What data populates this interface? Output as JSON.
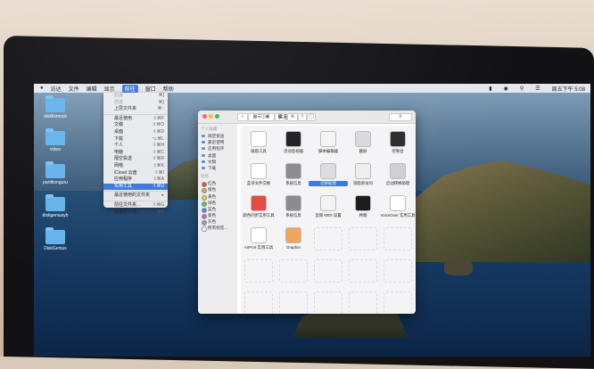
{
  "menubar": {
    "apple_icon": "apple-logo-icon",
    "items": [
      "访达",
      "文件",
      "编辑",
      "显示",
      "前往",
      "窗口",
      "帮助"
    ],
    "active_index": 4,
    "right_icons": [
      "battery-icon",
      "wifi-icon",
      "search-icon",
      "control-center-icon"
    ],
    "clock": "周五下午 5:08"
  },
  "desktop": {
    "icons": [
      {
        "label": "diskfixmock"
      },
      {
        "label": "video"
      },
      {
        "label": "partitionguru"
      },
      {
        "label": "diskgeniusyb"
      },
      {
        "label": "DiskGenius"
      }
    ]
  },
  "go_menu": {
    "items": [
      {
        "label": "后退",
        "shortcut": "⌘[",
        "dim": true
      },
      {
        "label": "前进",
        "shortcut": "⌘]",
        "dim": true
      },
      {
        "label": "上层文件夹",
        "shortcut": "⌘↑"
      },
      {
        "sep": true
      },
      {
        "label": "最近使用",
        "shortcut": "⇧⌘F"
      },
      {
        "label": "文稿",
        "shortcut": "⇧⌘O"
      },
      {
        "label": "桌面",
        "shortcut": "⇧⌘D"
      },
      {
        "label": "下载",
        "shortcut": "⌥⌘L"
      },
      {
        "label": "个人",
        "shortcut": "⇧⌘H"
      },
      {
        "label": "电脑",
        "shortcut": "⇧⌘C"
      },
      {
        "label": "隔空投送",
        "shortcut": "⇧⌘R"
      },
      {
        "label": "网络",
        "shortcut": "⇧⌘K"
      },
      {
        "label": "iCloud 云盘",
        "shortcut": "⇧⌘I"
      },
      {
        "label": "应用程序",
        "shortcut": "⇧⌘A"
      },
      {
        "label": "实用工具",
        "shortcut": "⇧⌘U",
        "selected": true
      },
      {
        "sep": true
      },
      {
        "label": "最近使用的文件夹",
        "shortcut": "▸"
      },
      {
        "sep": true
      },
      {
        "label": "前往文件夹…",
        "shortcut": "⇧⌘G"
      },
      {
        "label": "连接服务器…",
        "shortcut": "⌘K"
      }
    ]
  },
  "finder": {
    "title": "实用工具",
    "sidebar": {
      "favorites_header": "个人收藏",
      "favorites": [
        "隔空投送",
        "最近使用",
        "应用程序",
        "桌面",
        "文稿",
        "下载"
      ],
      "tags_header": "标签",
      "tags": [
        {
          "label": "红色",
          "color": "#e5483f"
        },
        {
          "label": "橙色",
          "color": "#f19a37"
        },
        {
          "label": "黄色",
          "color": "#f4cc3b"
        },
        {
          "label": "绿色",
          "color": "#5ec04f"
        },
        {
          "label": "蓝色",
          "color": "#3d8cf0"
        },
        {
          "label": "紫色",
          "color": "#b36bd6"
        },
        {
          "label": "灰色",
          "color": "#9a9a9e"
        },
        {
          "label": "所有标签…",
          "color": "#ffffff"
        }
      ]
    },
    "apps": [
      {
        "label": "磁盘工具",
        "icon": "stethoscope-icon",
        "color": "#ffffff"
      },
      {
        "label": "活动监视器",
        "icon": "activity-monitor-icon",
        "color": "#1c1c1e"
      },
      {
        "label": "脚本编辑器",
        "icon": "script-editor-icon",
        "color": "#f5f5f5"
      },
      {
        "label": "截屏",
        "icon": "screenshot-icon",
        "color": "#d9d9dc"
      },
      {
        "label": "控制台",
        "icon": "console-icon",
        "color": "#2b2b2b"
      },
      {
        "label": "蓝牙文件交换",
        "icon": "bluetooth-icon",
        "color": "#ffffff"
      },
      {
        "label": "系统信息",
        "icon": "system-info-icon",
        "color": "#8a8a8e"
      },
      {
        "label": "迁移助理",
        "icon": "migration-assistant-icon",
        "color": "#dcdce0",
        "selected": true
      },
      {
        "label": "钥匙串访问",
        "icon": "keychain-icon",
        "color": "#eeeeee"
      },
      {
        "label": "启动转换助理",
        "icon": "boot-camp-icon",
        "color": "#cfcfd3"
      },
      {
        "label": "颜色同步实用工具",
        "icon": "colorsync-icon",
        "color": "#e2483e"
      },
      {
        "label": "系统信息",
        "icon": "system-info-icon",
        "color": "#8a8a8e"
      },
      {
        "label": "音频 MIDI 设置",
        "icon": "midi-keyboard-icon",
        "color": "#f2f2f2"
      },
      {
        "label": "终端",
        "icon": "terminal-icon",
        "color": "#1a1a1a"
      },
      {
        "label": "VoiceOver 实用工具",
        "icon": "voiceover-icon",
        "color": "#ffffff"
      },
      {
        "label": "AirPort 实用工具",
        "icon": "airport-icon",
        "color": "#ffffff"
      },
      {
        "label": "Grapher",
        "icon": "grapher-icon",
        "color": "#f0a35a"
      }
    ]
  }
}
